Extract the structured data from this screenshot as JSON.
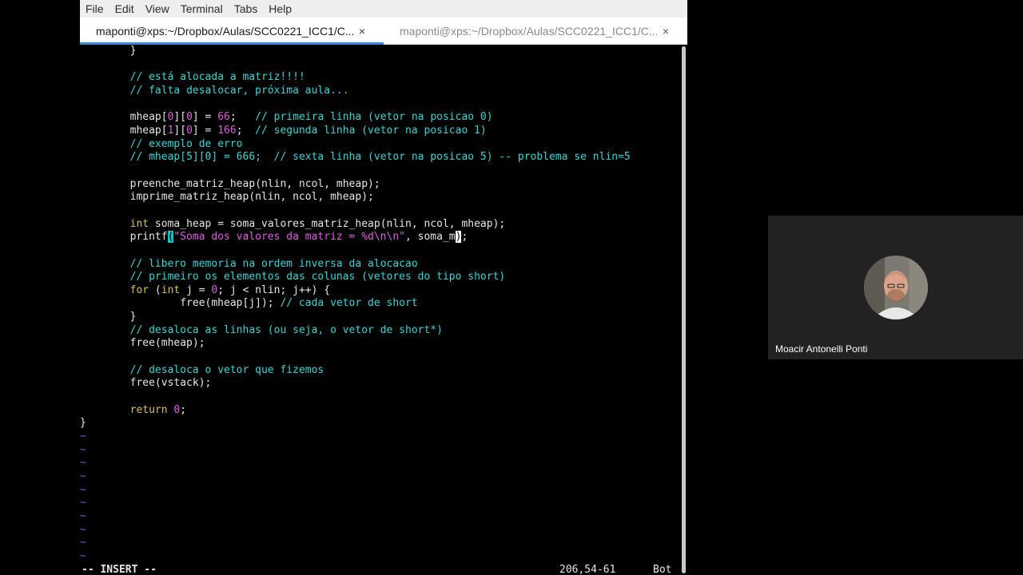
{
  "menubar": [
    "File",
    "Edit",
    "View",
    "Terminal",
    "Tabs",
    "Help"
  ],
  "tabs": [
    {
      "title": "maponti@xps:~/Dropbox/Aulas/SCC0221_ICC1/C...",
      "active": true
    },
    {
      "title": "maponti@xps:~/Dropbox/Aulas/SCC0221_ICC1/C...",
      "active": false
    }
  ],
  "tab_close_glyph": "×",
  "editor": {
    "lines": [
      [
        [
          "n",
          "        }"
        ]
      ],
      [
        [
          "n",
          ""
        ]
      ],
      [
        [
          "n",
          "        "
        ],
        [
          "cm",
          "// está alocada a matriz!!!!"
        ]
      ],
      [
        [
          "n",
          "        "
        ],
        [
          "cm",
          "// falta desalocar, próxima aula..."
        ]
      ],
      [
        [
          "n",
          ""
        ]
      ],
      [
        [
          "n",
          "        mheap["
        ],
        [
          "num",
          "0"
        ],
        [
          "n",
          "]["
        ],
        [
          "num",
          "0"
        ],
        [
          "n",
          "] = "
        ],
        [
          "num",
          "66"
        ],
        [
          "n",
          ";   "
        ],
        [
          "cm",
          "// primeira linha (vetor na posicao 0)"
        ]
      ],
      [
        [
          "n",
          "        mheap["
        ],
        [
          "num",
          "1"
        ],
        [
          "n",
          "]["
        ],
        [
          "num",
          "0"
        ],
        [
          "n",
          "] = "
        ],
        [
          "num",
          "166"
        ],
        [
          "n",
          ";  "
        ],
        [
          "cm",
          "// segunda linha (vetor na posicao 1)"
        ]
      ],
      [
        [
          "n",
          "        "
        ],
        [
          "cm",
          "// exemplo de erro"
        ]
      ],
      [
        [
          "n",
          "        "
        ],
        [
          "cm",
          "// mheap[5][0] = 666;  // sexta linha (vetor na posicao 5) -- problema se nlin=5"
        ]
      ],
      [
        [
          "n",
          ""
        ]
      ],
      [
        [
          "n",
          "        preenche_matriz_heap(nlin, ncol, mheap);"
        ]
      ],
      [
        [
          "n",
          "        imprime_matriz_heap(nlin, ncol, mheap);"
        ]
      ],
      [
        [
          "n",
          ""
        ]
      ],
      [
        [
          "n",
          "        "
        ],
        [
          "kw",
          "int"
        ],
        [
          "n",
          " soma_heap = soma_valores_matriz_heap(nlin, ncol, mheap);"
        ]
      ],
      [
        [
          "n",
          "        printf"
        ],
        [
          "cp",
          "("
        ],
        [
          "str",
          "\"Soma dos valores da matriz = %d\\n\\n\""
        ],
        [
          "n",
          ", soma_m"
        ],
        [
          "cb",
          ")"
        ],
        [
          "n",
          ";"
        ]
      ],
      [
        [
          "n",
          ""
        ]
      ],
      [
        [
          "n",
          "        "
        ],
        [
          "cm",
          "// libero memoria na ordem inversa da alocacao"
        ]
      ],
      [
        [
          "n",
          "        "
        ],
        [
          "cm",
          "// primeiro os elementos das colunas (vetores do tipo short)"
        ]
      ],
      [
        [
          "n",
          "        "
        ],
        [
          "kw",
          "for"
        ],
        [
          "n",
          " ("
        ],
        [
          "kw",
          "int"
        ],
        [
          "n",
          " j = "
        ],
        [
          "num",
          "0"
        ],
        [
          "n",
          "; j < nlin; j++) {"
        ]
      ],
      [
        [
          "n",
          "                free(mheap[j]); "
        ],
        [
          "cm",
          "// cada vetor de short"
        ]
      ],
      [
        [
          "n",
          "        }"
        ]
      ],
      [
        [
          "n",
          "        "
        ],
        [
          "cm",
          "// desaloca as linhas (ou seja, o vetor de short*)"
        ]
      ],
      [
        [
          "n",
          "        free(mheap);"
        ]
      ],
      [
        [
          "n",
          ""
        ]
      ],
      [
        [
          "n",
          "        "
        ],
        [
          "cm",
          "// desaloca o vetor que fizemos"
        ]
      ],
      [
        [
          "n",
          "        free(vstack);"
        ]
      ],
      [
        [
          "n",
          ""
        ]
      ],
      [
        [
          "n",
          "        "
        ],
        [
          "kw",
          "return"
        ],
        [
          "n",
          " "
        ],
        [
          "num",
          "0"
        ],
        [
          "n",
          ";"
        ]
      ],
      [
        [
          "n",
          "}"
        ]
      ],
      [
        [
          "t",
          "~"
        ]
      ],
      [
        [
          "t",
          "~"
        ]
      ],
      [
        [
          "t",
          "~"
        ]
      ],
      [
        [
          "t",
          "~"
        ]
      ],
      [
        [
          "t",
          "~"
        ]
      ],
      [
        [
          "t",
          "~"
        ]
      ],
      [
        [
          "t",
          "~"
        ]
      ],
      [
        [
          "t",
          "~"
        ]
      ],
      [
        [
          "t",
          "~"
        ]
      ],
      [
        [
          "t",
          "~"
        ]
      ]
    ]
  },
  "statusline": {
    "mode": "-- INSERT --",
    "cursor_position": "206,54-61",
    "scroll_position": "Bot"
  },
  "video": {
    "participant_name": "Moacir Antonelli Ponti"
  },
  "colors": {
    "comment": "#33d6d6",
    "number": "#e05ce0",
    "keyword": "#d8c24a",
    "tilde": "#3b6fd6",
    "tab_accent": "#3a89d6"
  }
}
